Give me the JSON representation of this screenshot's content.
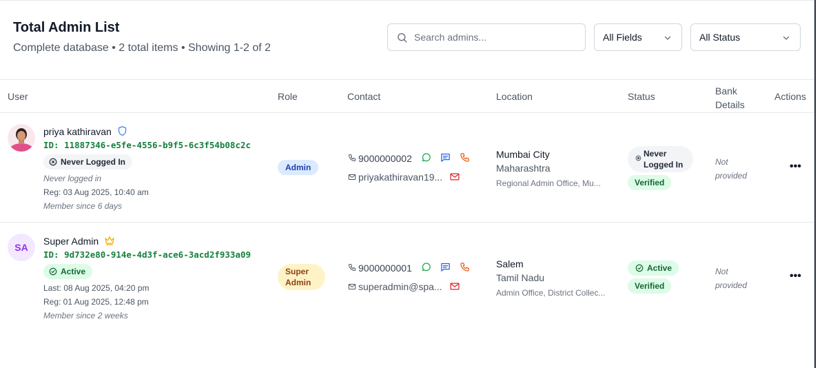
{
  "header": {
    "title": "Total Admin List",
    "subtitle": "Complete database • 2 total items • Showing 1-2 of 2"
  },
  "search": {
    "placeholder": "Search admins...",
    "value": ""
  },
  "filters": {
    "fields": "All Fields",
    "status": "All Status"
  },
  "table": {
    "columns": {
      "user": "User",
      "role": "Role",
      "contact": "Contact",
      "location": "Location",
      "status": "Status",
      "bank_line1": "Bank",
      "bank_line2": "Details",
      "actions": "Actions"
    },
    "rows": [
      {
        "name": "priya kathiravan",
        "badge_icon": "shield-icon",
        "id_text": "ID: 11887346-e5fe-4556-b9f5-6c3f54b08c2c",
        "login_pill": "Never Logged In",
        "meta1": "Never logged in",
        "meta2": "Reg: 03 Aug 2025, 10:40 am",
        "meta3": "Member since 6 days",
        "role": "Admin",
        "phone": "9000000002",
        "email": "priyakathiravan19...",
        "city": "Mumbai City",
        "state": "Maharashtra",
        "office": "Regional Admin Office, Mu...",
        "status_line1": "Never",
        "status_line2": "Logged In",
        "verified": "Verified",
        "bank_line1": "Not",
        "bank_line2": "provided",
        "actions": "•••"
      },
      {
        "avatar_initials": "SA",
        "name": "Super Admin",
        "badge_icon": "crown-icon",
        "id_text": "ID: 9d732e80-914e-4d3f-ace6-3acd2f933a09",
        "login_pill": "Active",
        "meta1": "Last: 08 Aug 2025, 04:20 pm",
        "meta2": "Reg: 01 Aug 2025, 12:48 pm",
        "meta3": "Member since 2 weeks",
        "role_line1": "Super",
        "role_line2": "Admin",
        "phone": "9000000001",
        "email": "superadmin@spa...",
        "city": "Salem",
        "state": "Tamil Nadu",
        "office": "Admin Office, District Collec...",
        "status": "Active",
        "verified": "Verified",
        "bank_line1": "Not",
        "bank_line2": "provided",
        "actions": "•••"
      }
    ]
  },
  "colors": {
    "id_green": "#15803d",
    "whatsapp_green": "#16a34a",
    "sms_blue": "#2563eb",
    "call_orange": "#ea580c",
    "mail_red": "#dc2626",
    "shield_blue": "#3b82f6",
    "crown_gold": "#eab308"
  }
}
